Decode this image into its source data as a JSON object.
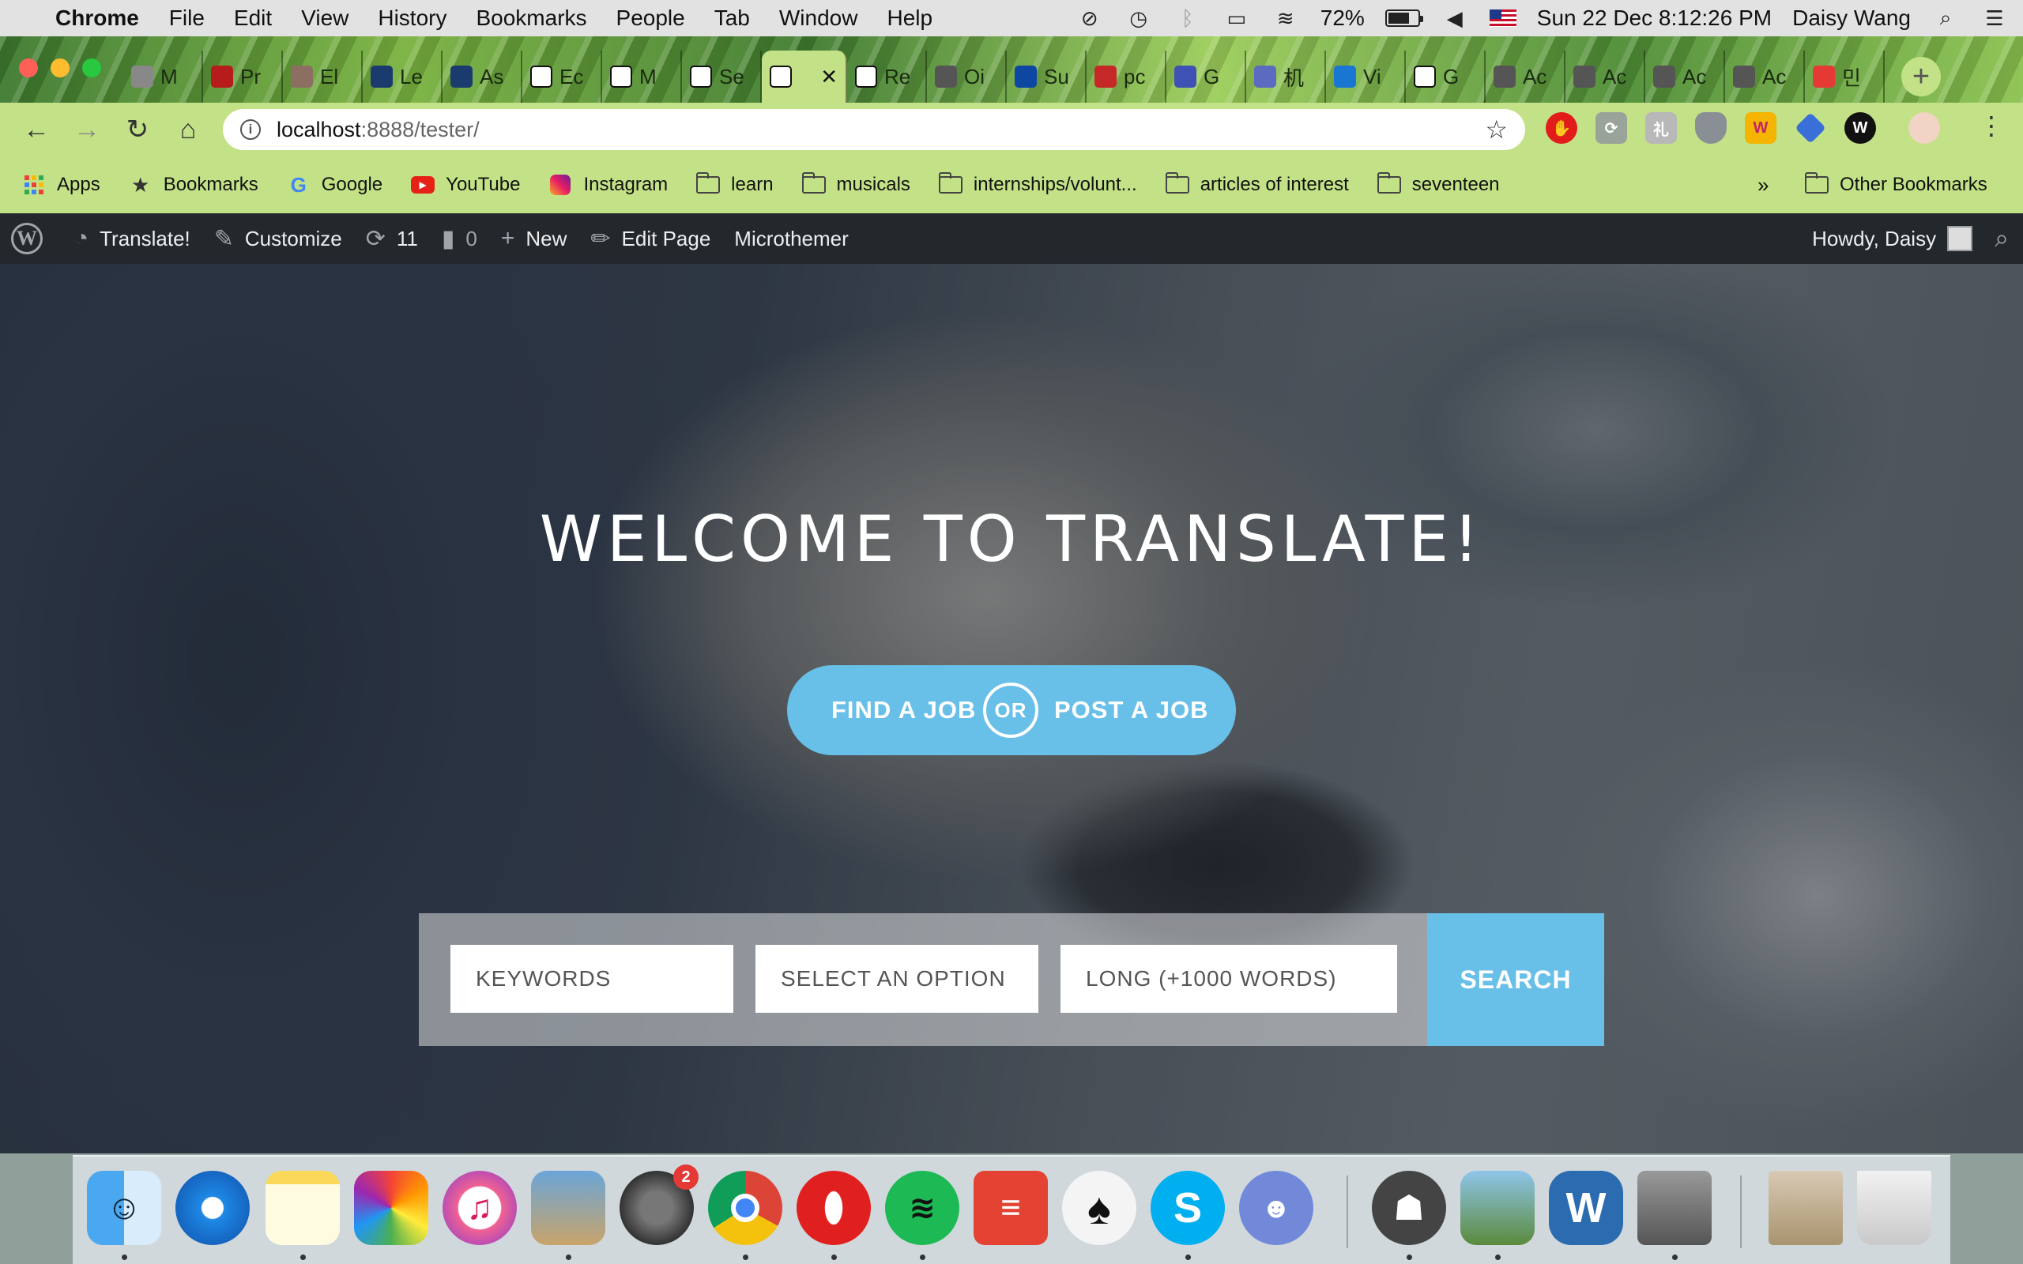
{
  "menubar": {
    "app_name": "Chrome",
    "items": [
      "File",
      "Edit",
      "View",
      "History",
      "Bookmarks",
      "People",
      "Tab",
      "Window",
      "Help"
    ],
    "battery": "72%",
    "datetime": "Sun 22 Dec  8:12:26 PM",
    "user": "Daisy Wang",
    "battery_level": 0.72
  },
  "tabs": [
    {
      "label": "M",
      "icon": "tab-favicon"
    },
    {
      "label": "Pr",
      "icon": "tab-favicon"
    },
    {
      "label": "El",
      "icon": "tab-favicon"
    },
    {
      "label": "Le",
      "icon": "tab-favicon"
    },
    {
      "label": "As",
      "icon": "tab-favicon"
    },
    {
      "label": "Ec",
      "icon": "tab-favicon"
    },
    {
      "label": "M",
      "icon": "tab-favicon"
    },
    {
      "label": "Se",
      "icon": "tab-favicon"
    },
    {
      "label": "",
      "icon": "tab-favicon",
      "active": true
    },
    {
      "label": "Re",
      "icon": "tab-favicon"
    },
    {
      "label": "Oi",
      "icon": "globe-icon"
    },
    {
      "label": "Su",
      "icon": "tab-favicon"
    },
    {
      "label": "pc",
      "icon": "tab-favicon"
    },
    {
      "label": "G",
      "icon": "tab-favicon"
    },
    {
      "label": "机",
      "icon": "tab-favicon"
    },
    {
      "label": "Vi",
      "icon": "tab-favicon"
    },
    {
      "label": "G",
      "icon": "google-icon"
    },
    {
      "label": "Ac",
      "icon": "globe-icon"
    },
    {
      "label": "Ac",
      "icon": "globe-icon"
    },
    {
      "label": "Ac",
      "icon": "globe-icon"
    },
    {
      "label": "Ac",
      "icon": "globe-icon"
    },
    {
      "label": "민",
      "icon": "youtube-icon"
    }
  ],
  "omnibox": {
    "host": "localhost",
    "path": ":8888/tester/"
  },
  "bookmarks": [
    {
      "label": "Apps",
      "icon": "apps-icon"
    },
    {
      "label": "Bookmarks",
      "icon": "star-icon"
    },
    {
      "label": "Google",
      "icon": "google-icon"
    },
    {
      "label": "YouTube",
      "icon": "youtube-icon"
    },
    {
      "label": "Instagram",
      "icon": "instagram-icon"
    },
    {
      "label": "learn",
      "icon": "folder-icon"
    },
    {
      "label": "musicals",
      "icon": "folder-icon"
    },
    {
      "label": "internships/volunt...",
      "icon": "folder-icon"
    },
    {
      "label": "articles of interest",
      "icon": "folder-icon"
    },
    {
      "label": "seventeen",
      "icon": "folder-icon"
    }
  ],
  "bookmarks_more": "»",
  "other_bookmarks": "Other Bookmarks",
  "wpbar": {
    "site": "Translate!",
    "customize": "Customize",
    "updates": "11",
    "comments": "0",
    "new": "New",
    "edit": "Edit Page",
    "microthemer": "Microthemer",
    "howdy": "Howdy, Daisy"
  },
  "hero": {
    "title": "WELCOME TO TRANSLATE!",
    "find": "FIND A JOB",
    "or": "OR",
    "post": "POST A JOB"
  },
  "search": {
    "keywords": "KEYWORDS",
    "option": "SELECT AN OPTION",
    "length": "LONG (+1000 WORDS)",
    "button": "SEARCH"
  },
  "dock": {
    "badge": "2"
  },
  "colors": {
    "accent": "#68bfe8",
    "wpbar": "#23282d",
    "chrome": "#c3e287"
  }
}
